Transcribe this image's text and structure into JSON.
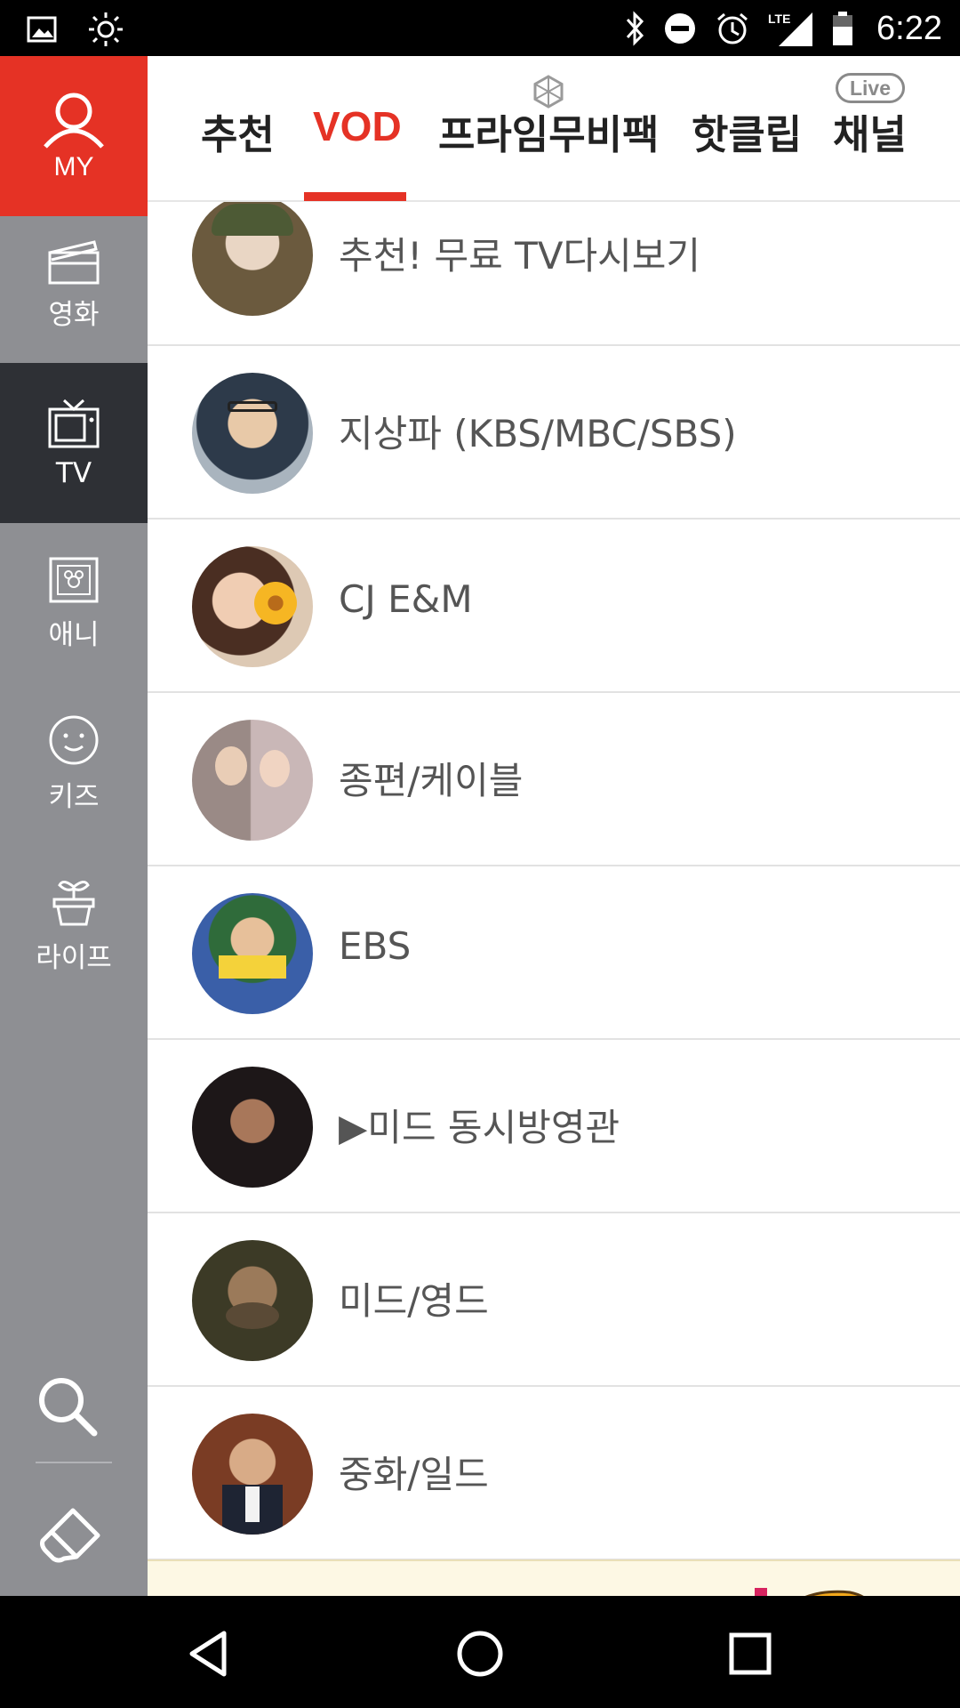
{
  "status": {
    "time": "6:22",
    "network": "LTE"
  },
  "sidebar": {
    "my": "MY",
    "items": [
      {
        "label": "영화",
        "icon": "clapperboard-icon"
      },
      {
        "label": "TV",
        "icon": "tv-icon"
      },
      {
        "label": "애니",
        "icon": "film-frame-icon"
      },
      {
        "label": "키즈",
        "icon": "smiley-icon"
      },
      {
        "label": "라이프",
        "icon": "plant-icon"
      }
    ]
  },
  "tabs": {
    "items": [
      "추천",
      "VOD",
      "프라임무비팩",
      "핫클립",
      "채널"
    ],
    "selected": "VOD",
    "live_badge": "Live"
  },
  "list": [
    "추천! 무료 TV다시보기",
    "지상파 (KBS/MBC/SBS)",
    "CJ E&M",
    "종편/케이블",
    "EBS",
    "▶미드 동시방영관",
    "미드/영드",
    "중화/일드"
  ],
  "colors": {
    "accent": "#e53225",
    "sidebar": "#8e8f93",
    "sidebar_active": "#2e3035"
  }
}
